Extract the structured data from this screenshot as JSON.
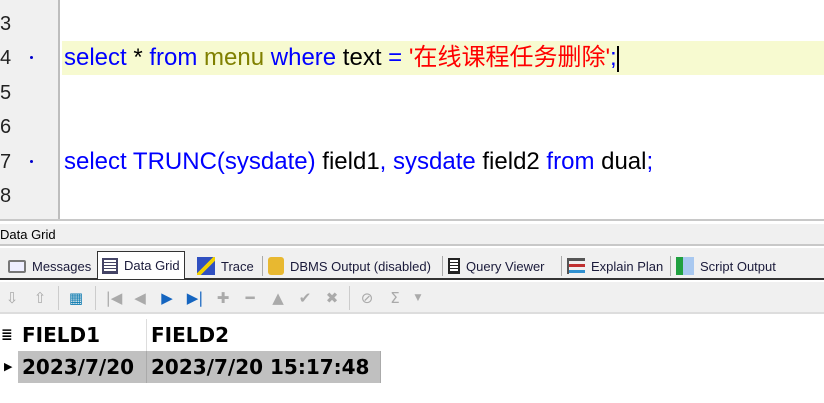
{
  "editor": {
    "lines": [
      {
        "num": "3"
      },
      {
        "num": "4",
        "marker": true,
        "tokens": [
          "select",
          " * ",
          "from",
          " menu",
          " where",
          " text",
          " = ",
          "'在线课程任务删除'",
          ";"
        ]
      },
      {
        "num": "5"
      },
      {
        "num": "6"
      },
      {
        "num": "7",
        "marker": true,
        "tokens": [
          "select TRUNC(sysdate)",
          " field1",
          ", sysdate",
          " field2",
          " from",
          " dual",
          ";"
        ]
      },
      {
        "num": "8"
      }
    ]
  },
  "panel_title": "Data Grid",
  "tabs": [
    {
      "label": "Messages",
      "icon": "messages-icon"
    },
    {
      "label": "Data Grid",
      "icon": "data-grid-icon",
      "active": true
    },
    {
      "label": "Trace",
      "icon": "trace-icon"
    },
    {
      "label": "DBMS Output (disabled)",
      "icon": "dbms-output-icon"
    },
    {
      "label": "Query Viewer",
      "icon": "query-viewer-icon"
    },
    {
      "label": "Explain Plan",
      "icon": "explain-plan-icon"
    },
    {
      "label": "Script Output",
      "icon": "script-output-icon"
    }
  ],
  "toolbar": {
    "sum_symbol": "Σ"
  },
  "grid": {
    "columns": [
      "FIELD1",
      "FIELD2"
    ],
    "rows": [
      [
        "2023/7/20",
        "2023/7/20 15:17:48"
      ]
    ]
  },
  "colors": {
    "keyword": "#0000ff",
    "object": "#808000",
    "string": "#ff0000",
    "current_line": "#f7fad0",
    "row_selected": "#c0c0c0"
  }
}
